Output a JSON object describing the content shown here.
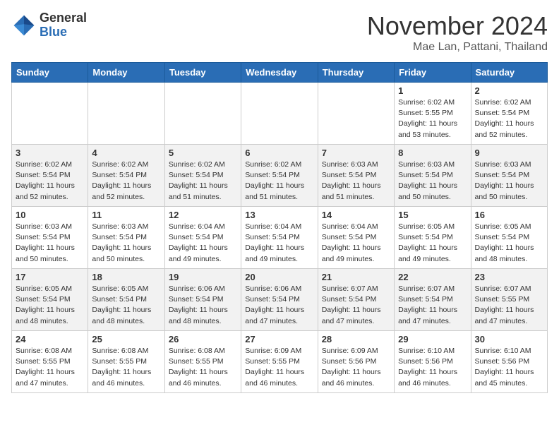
{
  "header": {
    "logo_general": "General",
    "logo_blue": "Blue",
    "month": "November 2024",
    "location": "Mae Lan, Pattani, Thailand"
  },
  "weekdays": [
    "Sunday",
    "Monday",
    "Tuesday",
    "Wednesday",
    "Thursday",
    "Friday",
    "Saturday"
  ],
  "weeks": [
    [
      {
        "day": "",
        "info": ""
      },
      {
        "day": "",
        "info": ""
      },
      {
        "day": "",
        "info": ""
      },
      {
        "day": "",
        "info": ""
      },
      {
        "day": "",
        "info": ""
      },
      {
        "day": "1",
        "info": "Sunrise: 6:02 AM\nSunset: 5:55 PM\nDaylight: 11 hours\nand 53 minutes."
      },
      {
        "day": "2",
        "info": "Sunrise: 6:02 AM\nSunset: 5:54 PM\nDaylight: 11 hours\nand 52 minutes."
      }
    ],
    [
      {
        "day": "3",
        "info": "Sunrise: 6:02 AM\nSunset: 5:54 PM\nDaylight: 11 hours\nand 52 minutes."
      },
      {
        "day": "4",
        "info": "Sunrise: 6:02 AM\nSunset: 5:54 PM\nDaylight: 11 hours\nand 52 minutes."
      },
      {
        "day": "5",
        "info": "Sunrise: 6:02 AM\nSunset: 5:54 PM\nDaylight: 11 hours\nand 51 minutes."
      },
      {
        "day": "6",
        "info": "Sunrise: 6:02 AM\nSunset: 5:54 PM\nDaylight: 11 hours\nand 51 minutes."
      },
      {
        "day": "7",
        "info": "Sunrise: 6:03 AM\nSunset: 5:54 PM\nDaylight: 11 hours\nand 51 minutes."
      },
      {
        "day": "8",
        "info": "Sunrise: 6:03 AM\nSunset: 5:54 PM\nDaylight: 11 hours\nand 50 minutes."
      },
      {
        "day": "9",
        "info": "Sunrise: 6:03 AM\nSunset: 5:54 PM\nDaylight: 11 hours\nand 50 minutes."
      }
    ],
    [
      {
        "day": "10",
        "info": "Sunrise: 6:03 AM\nSunset: 5:54 PM\nDaylight: 11 hours\nand 50 minutes."
      },
      {
        "day": "11",
        "info": "Sunrise: 6:03 AM\nSunset: 5:54 PM\nDaylight: 11 hours\nand 50 minutes."
      },
      {
        "day": "12",
        "info": "Sunrise: 6:04 AM\nSunset: 5:54 PM\nDaylight: 11 hours\nand 49 minutes."
      },
      {
        "day": "13",
        "info": "Sunrise: 6:04 AM\nSunset: 5:54 PM\nDaylight: 11 hours\nand 49 minutes."
      },
      {
        "day": "14",
        "info": "Sunrise: 6:04 AM\nSunset: 5:54 PM\nDaylight: 11 hours\nand 49 minutes."
      },
      {
        "day": "15",
        "info": "Sunrise: 6:05 AM\nSunset: 5:54 PM\nDaylight: 11 hours\nand 49 minutes."
      },
      {
        "day": "16",
        "info": "Sunrise: 6:05 AM\nSunset: 5:54 PM\nDaylight: 11 hours\nand 48 minutes."
      }
    ],
    [
      {
        "day": "17",
        "info": "Sunrise: 6:05 AM\nSunset: 5:54 PM\nDaylight: 11 hours\nand 48 minutes."
      },
      {
        "day": "18",
        "info": "Sunrise: 6:05 AM\nSunset: 5:54 PM\nDaylight: 11 hours\nand 48 minutes."
      },
      {
        "day": "19",
        "info": "Sunrise: 6:06 AM\nSunset: 5:54 PM\nDaylight: 11 hours\nand 48 minutes."
      },
      {
        "day": "20",
        "info": "Sunrise: 6:06 AM\nSunset: 5:54 PM\nDaylight: 11 hours\nand 47 minutes."
      },
      {
        "day": "21",
        "info": "Sunrise: 6:07 AM\nSunset: 5:54 PM\nDaylight: 11 hours\nand 47 minutes."
      },
      {
        "day": "22",
        "info": "Sunrise: 6:07 AM\nSunset: 5:54 PM\nDaylight: 11 hours\nand 47 minutes."
      },
      {
        "day": "23",
        "info": "Sunrise: 6:07 AM\nSunset: 5:55 PM\nDaylight: 11 hours\nand 47 minutes."
      }
    ],
    [
      {
        "day": "24",
        "info": "Sunrise: 6:08 AM\nSunset: 5:55 PM\nDaylight: 11 hours\nand 47 minutes."
      },
      {
        "day": "25",
        "info": "Sunrise: 6:08 AM\nSunset: 5:55 PM\nDaylight: 11 hours\nand 46 minutes."
      },
      {
        "day": "26",
        "info": "Sunrise: 6:08 AM\nSunset: 5:55 PM\nDaylight: 11 hours\nand 46 minutes."
      },
      {
        "day": "27",
        "info": "Sunrise: 6:09 AM\nSunset: 5:55 PM\nDaylight: 11 hours\nand 46 minutes."
      },
      {
        "day": "28",
        "info": "Sunrise: 6:09 AM\nSunset: 5:56 PM\nDaylight: 11 hours\nand 46 minutes."
      },
      {
        "day": "29",
        "info": "Sunrise: 6:10 AM\nSunset: 5:56 PM\nDaylight: 11 hours\nand 46 minutes."
      },
      {
        "day": "30",
        "info": "Sunrise: 6:10 AM\nSunset: 5:56 PM\nDaylight: 11 hours\nand 45 minutes."
      }
    ]
  ]
}
